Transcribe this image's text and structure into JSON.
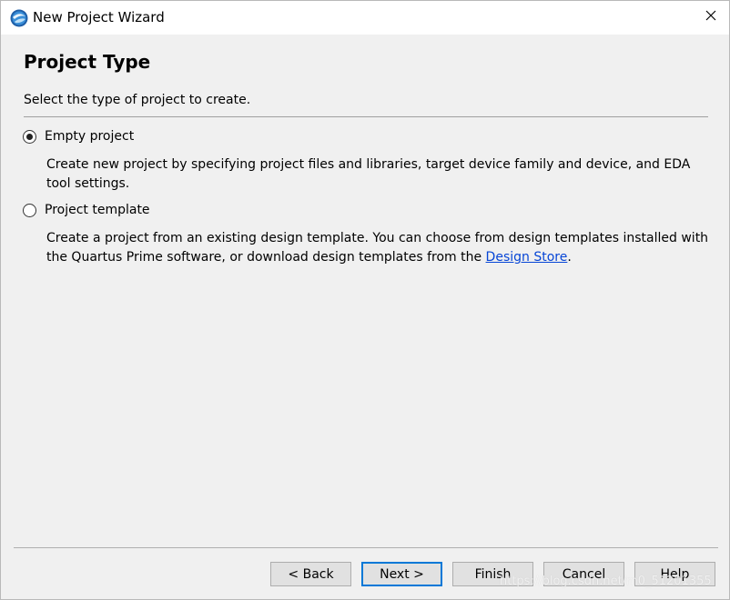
{
  "window": {
    "title": "New Project Wizard"
  },
  "page": {
    "heading": "Project Type",
    "subtitle": "Select the type of project to create."
  },
  "options": [
    {
      "label": "Empty project",
      "selected": true,
      "description": "Create new project by specifying project files and libraries, target device family and device, and EDA tool settings."
    },
    {
      "label": "Project template",
      "selected": false,
      "description_before_link": "Create a project from an existing design template. You can choose from design templates installed with the Quartus Prime software, or download design templates from the ",
      "link_text": "Design Store",
      "description_after_link": "."
    }
  ],
  "buttons": {
    "back": "< Back",
    "next": "Next >",
    "finish": "Finish",
    "cancel": "Cancel",
    "help": "Help"
  },
  "icons": {
    "app": "quartus-logo-icon",
    "close": "close-icon"
  },
  "colors": {
    "link": "#0645d6",
    "default_button_border": "#0078d7"
  },
  "watermark": "https://blog.csdn.net/m0_51201355"
}
